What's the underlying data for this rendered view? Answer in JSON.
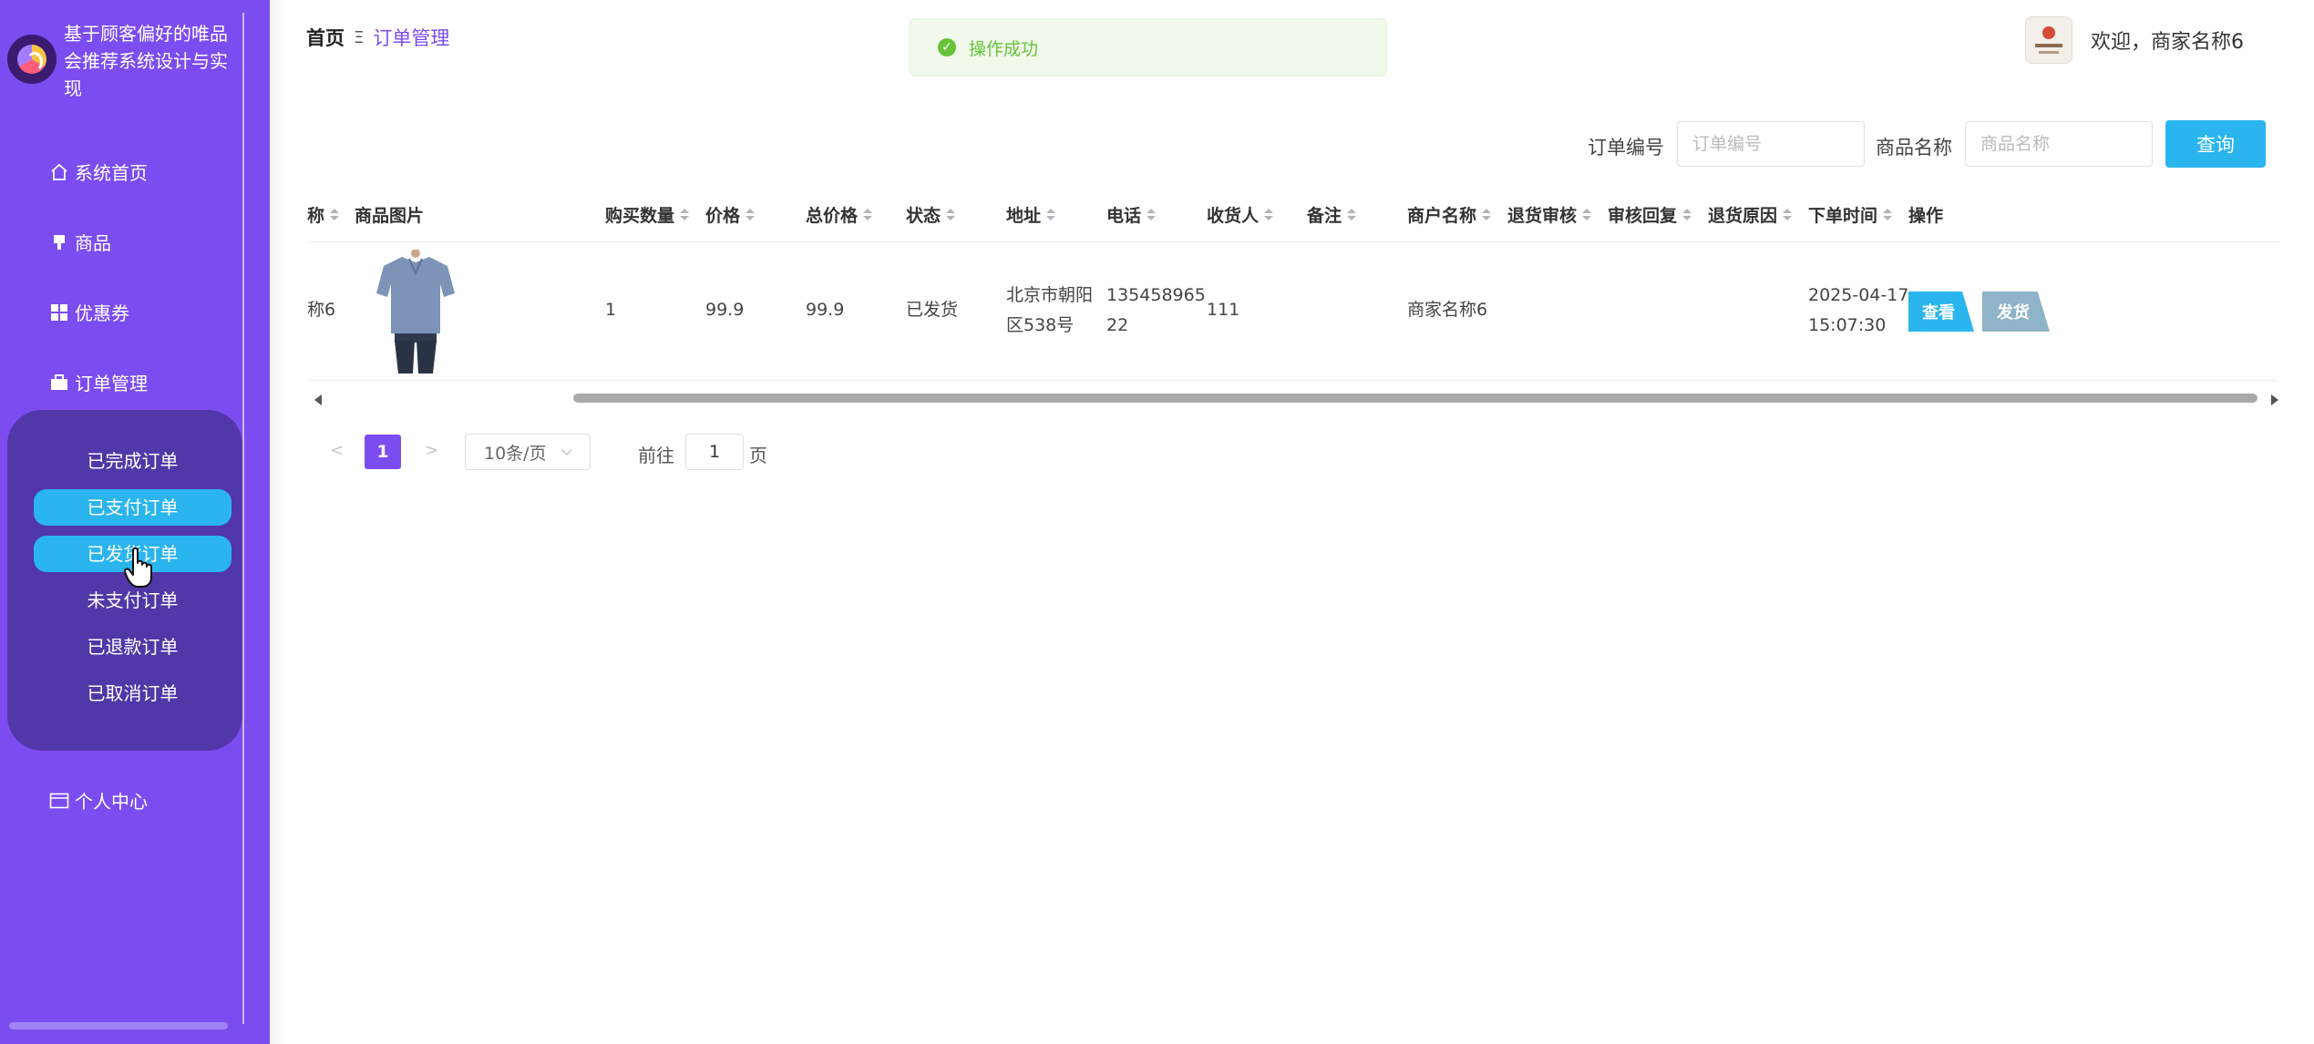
{
  "sidebar": {
    "title": "基于顾客偏好的唯品会推荐系统设计与实现",
    "items": [
      {
        "label": "系统首页",
        "icon": "home-icon"
      },
      {
        "label": "商品",
        "icon": "product-icon"
      },
      {
        "label": "优惠券",
        "icon": "grid-icon"
      },
      {
        "label": "订单管理",
        "icon": "briefcase-icon"
      }
    ],
    "submenu": [
      {
        "label": "已完成订单",
        "active": false
      },
      {
        "label": "已支付订单",
        "active": true
      },
      {
        "label": "已发货订单",
        "active": true
      },
      {
        "label": "未支付订单",
        "active": false
      },
      {
        "label": "已退款订单",
        "active": false
      },
      {
        "label": "已取消订单",
        "active": false
      }
    ],
    "profile": {
      "label": "个人中心",
      "icon": "card-icon"
    }
  },
  "header": {
    "breadcrumb_home": "首页",
    "breadcrumb_sep": "Ξ",
    "breadcrumb_current": "订单管理",
    "toast": "操作成功",
    "welcome": "欢迎，商家名称6"
  },
  "search": {
    "order_no_label": "订单编号",
    "order_no_placeholder": "订单编号",
    "product_label": "商品名称",
    "product_placeholder": "商品名称",
    "query_button": "查询"
  },
  "table": {
    "headers": {
      "name_partial": "称",
      "image": "商品图片",
      "quantity": "购买数量",
      "price": "价格",
      "total": "总价格",
      "status": "状态",
      "address": "地址",
      "phone": "电话",
      "receiver": "收货人",
      "remark": "备注",
      "merchant": "商户名称",
      "refund_review": "退货审核",
      "review_reply": "审核回复",
      "refund_reason": "退货原因",
      "order_time": "下单时间",
      "actions": "操作"
    },
    "row": {
      "name_partial": "称6",
      "quantity": "1",
      "price": "99.9",
      "total": "99.9",
      "status": "已发货",
      "address_line1": "北京市朝阳",
      "address_line2": "区538号",
      "phone_line1": "135458965",
      "phone_line2": "22",
      "receiver": "111",
      "remark": "",
      "merchant": "商家名称6",
      "order_date": "2025-04-17",
      "order_clock": "15:07:30",
      "view_button": "查看",
      "ship_button": "发货"
    }
  },
  "pagination": {
    "prev": "<",
    "current_page": "1",
    "next": ">",
    "page_size": "10条/页",
    "goto_label": "前往",
    "goto_value": "1",
    "page_suffix": "页"
  },
  "colors": {
    "sidebar": "#7b4df1",
    "submenu": "#5237a8",
    "accent": "#2bb5ee",
    "success": "#67c23a"
  }
}
